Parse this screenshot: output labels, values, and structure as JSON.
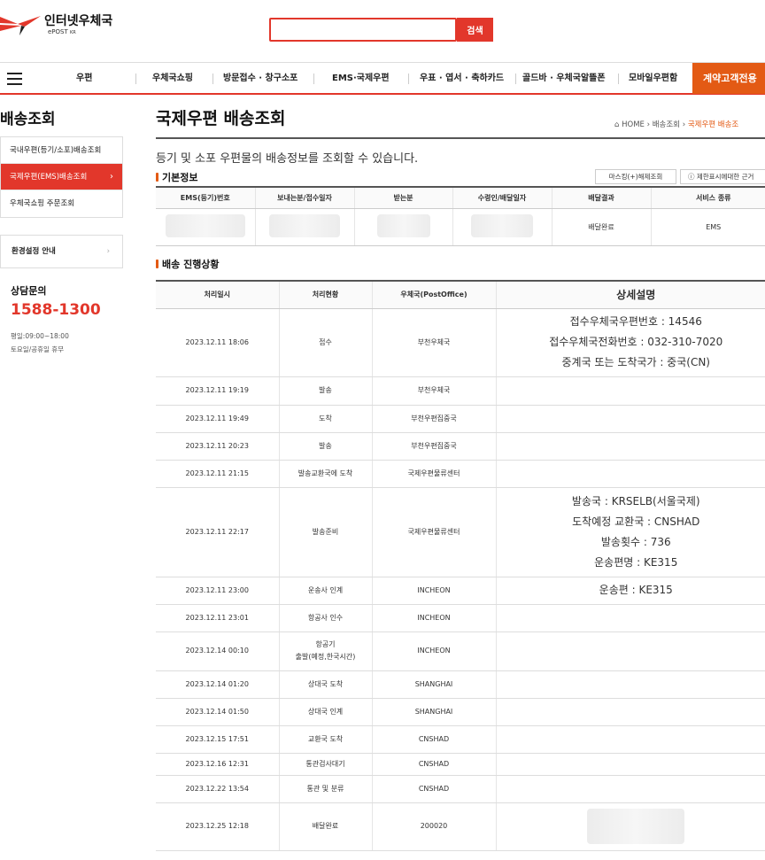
{
  "header": {
    "logo_name": "인터넷우체국",
    "logo_sub": "ePOST",
    "logo_sub_small": "KR",
    "search_value": "",
    "search_button": "검색"
  },
  "nav": {
    "items": [
      "우편",
      "우체국쇼핑",
      "방문접수 · 창구소포",
      "EMS·국제우편",
      "우표 · 엽서 · 축하카드",
      "골드바 · 우체국알뜰폰",
      "모바일우편함"
    ],
    "cta": "계약고객전용"
  },
  "sidebar": {
    "title": "배송조회",
    "items": [
      "국내우편(등기/소포)배송조회",
      "국제우편(EMS)배송조회",
      "우체국쇼핑 주문조회"
    ],
    "env": "환경설정 안내",
    "consult_label": "상담문의",
    "phone": "1588-1300",
    "hours_weekday": "평일:09:00~18:00",
    "hours_weekend": "토요일/공휴일 휴무"
  },
  "main": {
    "title": "국제우편 배송조회",
    "breadcrumb": [
      "HOME",
      "배송조회",
      "국제우편 배송조"
    ],
    "intro": "등기 및 소포 우편물의 배송정보를 조회할 수 있습니다.",
    "basic_title": "기본정보",
    "mask_button": "마스킹(+)해제조회",
    "limit_button": "ⓘ 제한표시에대한 근거",
    "basic_headers": [
      "EMS(등기)번호",
      "보내는분/접수일자",
      "받는분",
      "수령인/배달일자",
      "배달결과",
      "서비스 종류"
    ],
    "basic_row": [
      "",
      "",
      "",
      "",
      "배달완료",
      "EMS"
    ],
    "progress_title": "배송 진행상황",
    "progress_headers": [
      "처리일시",
      "처리현황",
      "우체국(PostOffice)",
      "상세설명"
    ],
    "events": [
      {
        "time": "2023.12.11 18:06",
        "status": "접수",
        "office": "부천우체국",
        "detail": [
          "접수우체국우편번호 : 14546",
          "접수우체국전화번호 : 032-310-7020",
          "중계국 또는 도착국가 : 중국(CN)"
        ]
      },
      {
        "time": "2023.12.11 19:19",
        "status": "발송",
        "office": "부천우체국",
        "detail": []
      },
      {
        "time": "2023.12.11 19:49",
        "status": "도착",
        "office": "부천우편집중국",
        "detail": []
      },
      {
        "time": "2023.12.11 20:23",
        "status": "발송",
        "office": "부천우편집중국",
        "detail": []
      },
      {
        "time": "2023.12.11 21:15",
        "status": "발송교환국에 도착",
        "office": "국제우편물류센터",
        "detail": []
      },
      {
        "time": "2023.12.11 22:17",
        "status": "발송준비",
        "office": "국제우편물류센터",
        "detail": [
          "발송국 : KRSELB(서울국제)",
          "도착예정 교환국 : CNSHAD",
          "발송횟수 : 736",
          "운송편명 : KE315"
        ]
      },
      {
        "time": "2023.12.11 23:00",
        "status": "운송사 인계",
        "office": "INCHEON",
        "detail": [
          "운송편 : KE315"
        ]
      },
      {
        "time": "2023.12.11 23:01",
        "status": "항공사 인수",
        "office": "INCHEON",
        "detail": []
      },
      {
        "time": "2023.12.14 00:10",
        "status": "항공기",
        "status2": "출발(예정,한국시간)",
        "office": "INCHEON",
        "detail": []
      },
      {
        "time": "2023.12.14 01:20",
        "status": "상대국 도착",
        "office": "SHANGHAI",
        "detail": []
      },
      {
        "time": "2023.12.14 01:50",
        "status": "상대국 인계",
        "office": "SHANGHAI",
        "detail": []
      },
      {
        "time": "2023.12.15 17:51",
        "status": "교환국 도착",
        "office": "CNSHAD",
        "detail": []
      },
      {
        "time": "2023.12.16 12:31",
        "status": "통관검사대기",
        "office": "CNSHAD",
        "detail": []
      },
      {
        "time": "2023.12.22 13:54",
        "status": "통관 및 분류",
        "office": "CNSHAD",
        "detail": []
      },
      {
        "time": "2023.12.25 12:18",
        "status": "배달완료",
        "office": "200020",
        "detail": []
      }
    ]
  },
  "colors": {
    "accent": "#e2372b",
    "orange": "#e35a14"
  }
}
